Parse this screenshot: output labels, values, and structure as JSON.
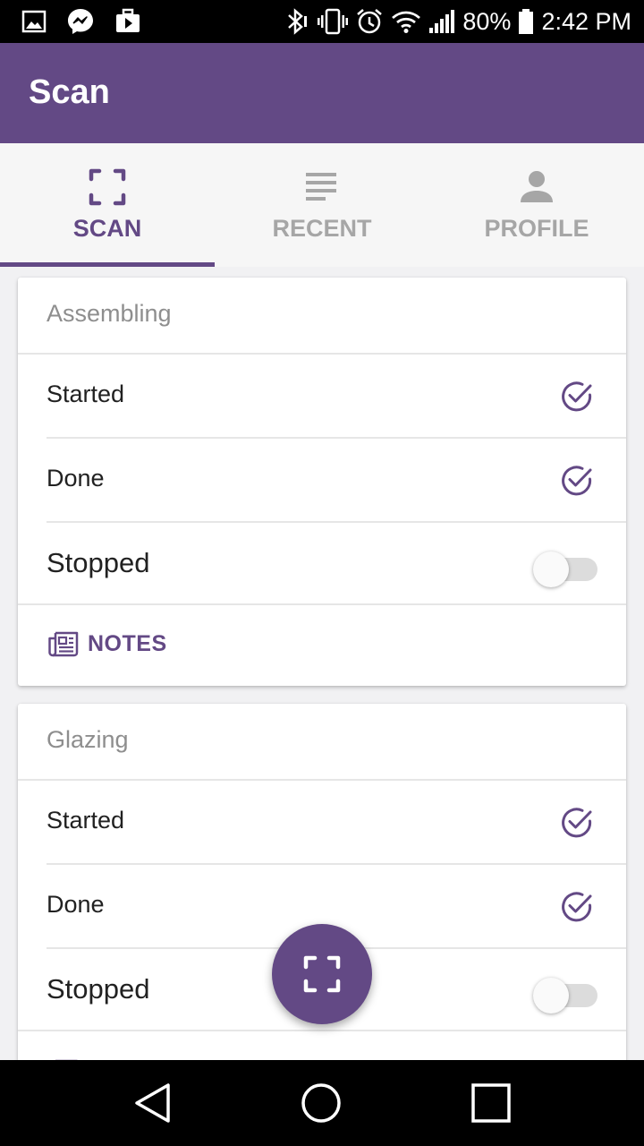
{
  "status_bar": {
    "battery_percent": "80%",
    "time": "2:42 PM",
    "icons": [
      "gallery-icon",
      "messenger-icon",
      "media-icon",
      "bluetooth-icon",
      "vibrate-icon",
      "alarm-icon",
      "wifi-icon",
      "signal-icon",
      "battery-icon"
    ]
  },
  "app_bar": {
    "title": "Scan"
  },
  "tabs": [
    {
      "label": "SCAN",
      "icon": "scan-frame-icon",
      "active": true
    },
    {
      "label": "RECENT",
      "icon": "list-icon",
      "active": false
    },
    {
      "label": "PROFILE",
      "icon": "person-icon",
      "active": false
    }
  ],
  "cards": [
    {
      "title": "Assembling",
      "rows": [
        {
          "label": "Started",
          "control": "check"
        },
        {
          "label": "Done",
          "control": "check"
        },
        {
          "label": "Stopped",
          "control": "toggle",
          "on": false
        }
      ],
      "notes_label": "NOTES"
    },
    {
      "title": "Glazing",
      "rows": [
        {
          "label": "Started",
          "control": "check"
        },
        {
          "label": "Done",
          "control": "check"
        },
        {
          "label": "Stopped",
          "control": "toggle",
          "on": false
        }
      ]
    }
  ],
  "fab": {
    "icon": "scan-frame-icon"
  },
  "nav_bar": {
    "icons": [
      "back-icon",
      "home-icon",
      "recents-icon"
    ]
  },
  "colors": {
    "primary": "#634985",
    "tab_inactive": "#a6a6a6",
    "background": "#f1f1f3"
  }
}
